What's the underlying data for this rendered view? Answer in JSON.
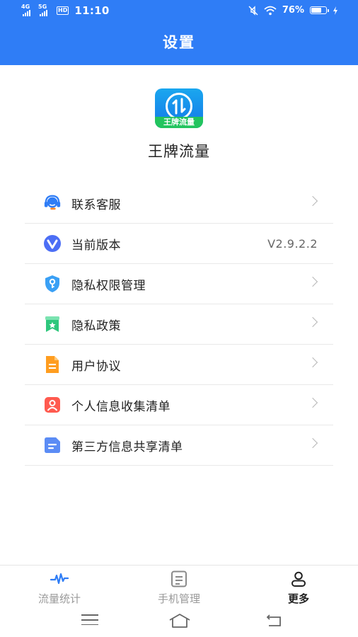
{
  "status_bar": {
    "net1": "4G",
    "net2": "5G",
    "hd": "HD",
    "time": "11:10",
    "battery_percent": "76%",
    "battery_level": 0.76,
    "icons": [
      "mute-icon",
      "wifi-icon",
      "battery-icon",
      "charging-icon"
    ]
  },
  "header": {
    "title": "设置"
  },
  "app": {
    "logo_text": "王牌流量",
    "name": "王牌流量"
  },
  "menu": [
    {
      "label": "联系客服",
      "icon": "headset-icon",
      "trailing": "chevron"
    },
    {
      "label": "当前版本",
      "icon": "version-icon",
      "trailing": "V2.9.2.2"
    },
    {
      "label": "隐私权限管理",
      "icon": "shield-key-icon",
      "trailing": "chevron"
    },
    {
      "label": "隐私政策",
      "icon": "bookmark-star-icon",
      "trailing": "chevron"
    },
    {
      "label": "用户协议",
      "icon": "document-icon",
      "trailing": "chevron"
    },
    {
      "label": "个人信息收集清单",
      "icon": "person-card-icon",
      "trailing": "chevron"
    },
    {
      "label": "第三方信息共享清单",
      "icon": "list-doc-icon",
      "trailing": "chevron"
    }
  ],
  "tabs": [
    {
      "label": "流量统计",
      "icon": "pulse-icon",
      "active": false
    },
    {
      "label": "手机管理",
      "icon": "clipboard-icon",
      "active": false
    },
    {
      "label": "更多",
      "icon": "user-icon",
      "active": true
    }
  ],
  "colors": {
    "brand_blue": "#2f7df6",
    "active_icon": "#2f7df6",
    "text_dark": "#222222",
    "text_muted": "#999999"
  }
}
